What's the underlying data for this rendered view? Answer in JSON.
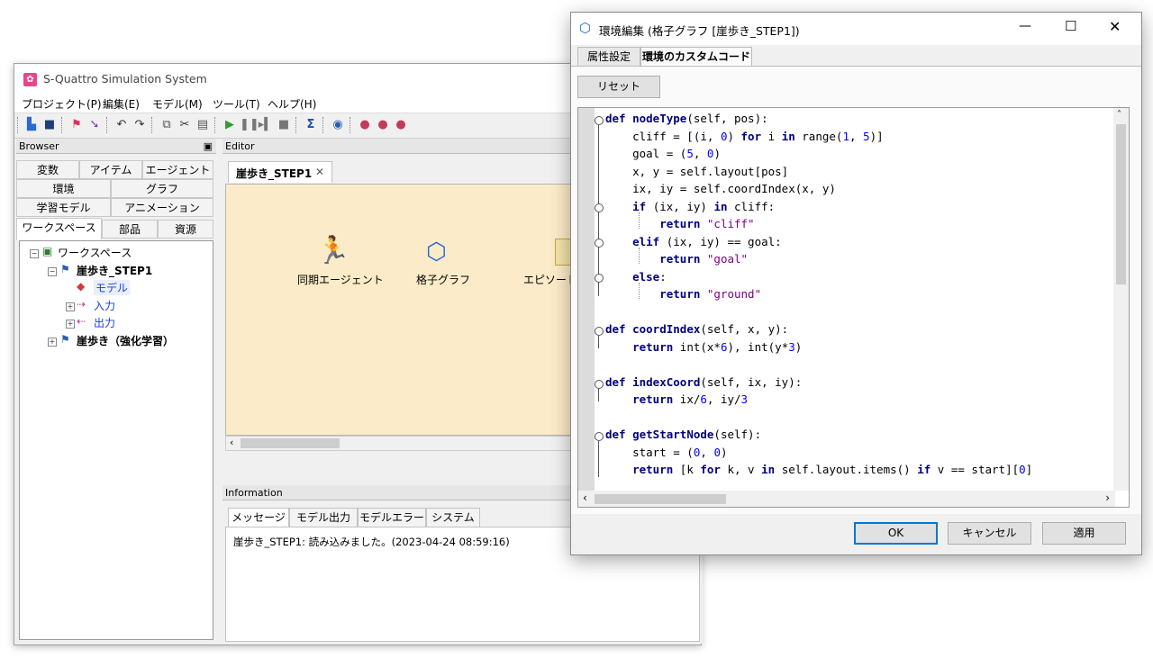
{
  "main_window": {
    "title": "S-Quattro Simulation System",
    "menu": [
      "プロジェクト(P)",
      "編集(E)",
      "モデル(M)",
      "ツール(T)",
      "ヘルプ(H)"
    ]
  },
  "browser": {
    "header": "Browser",
    "tabs_row1": [
      "変数",
      "アイテム",
      "エージェント"
    ],
    "tabs_row2": [
      "環境",
      "グラフ"
    ],
    "tabs_row3": [
      "学習モデル",
      "アニメーション"
    ],
    "tabs_row4": [
      "ワークスペース",
      "部品",
      "資源"
    ],
    "tree": {
      "root": "ワークスペース",
      "project1": "崖歩き_STEP1",
      "model": "モデル",
      "input": "入力",
      "output": "出力",
      "project2": "崖歩き（強化学習）"
    }
  },
  "editor": {
    "header": "Editor",
    "tab": "崖歩き_STEP1",
    "nodes": [
      "同期エージェント",
      "格子グラフ",
      "エピソード"
    ]
  },
  "information": {
    "header": "Information",
    "tabs": [
      "メッセージ",
      "モデル出力",
      "モデルエラー",
      "システム"
    ],
    "message": "崖歩き_STEP1: 読み込みました。(2023-04-24 08:59:16)"
  },
  "dialog": {
    "title": "環境編集 (格子グラフ [崖歩き_STEP1])",
    "tabs": [
      "属性設定",
      "環境のカスタムコード"
    ],
    "reset": "リセット",
    "ok": "OK",
    "cancel": "キャンセル",
    "apply": "適用"
  },
  "code_lines": [
    "def nodeType(self, pos):",
    "    cliff = [(i, 0) for i in range(1, 5)]",
    "    goal = (5, 0)",
    "    x, y = self.layout[pos]",
    "    ix, iy = self.coordIndex(x, y)",
    "    if (ix, iy) in cliff:",
    "        return \"cliff\"",
    "    elif (ix, iy) == goal:",
    "        return \"goal\"",
    "    else:",
    "        return \"ground\"",
    "",
    "def coordIndex(self, x, y):",
    "    return int(x*6), int(y*3)",
    "",
    "def indexCoord(self, ix, iy):",
    "    return ix/6, iy/3",
    "",
    "def getStartNode(self):",
    "    start = (0, 0)",
    "    return [k for k, v in self.layout.items() if v == start][0]"
  ]
}
